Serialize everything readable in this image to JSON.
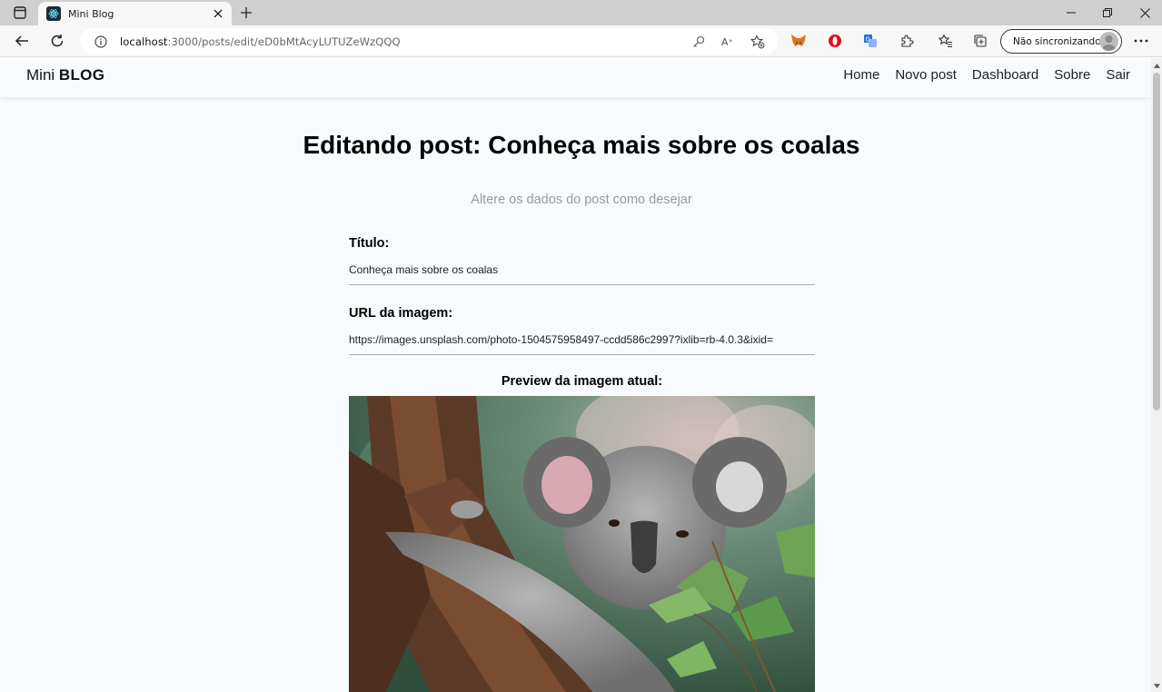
{
  "browser": {
    "tab_title": "Mini Blog",
    "url_host": "localhost",
    "url_path": ":3000/posts/edit/eD0bMtAcyLUTUZeWzQQQ",
    "sync_label": "Não sincronizando"
  },
  "navbar": {
    "brand_light": "Mini ",
    "brand_bold": "BLOG",
    "links": [
      {
        "label": "Home"
      },
      {
        "label": "Novo post"
      },
      {
        "label": "Dashboard"
      },
      {
        "label": "Sobre"
      },
      {
        "label": "Sair"
      }
    ]
  },
  "page": {
    "title": "Editando post: Conheça mais sobre os coalas",
    "subtitle": "Altere os dados do post como desejar"
  },
  "form": {
    "title_label": "Título:",
    "title_value": "Conheça mais sobre os coalas",
    "image_label": "URL da imagem:",
    "image_value": "https://images.unsplash.com/photo-1504575958497-ccdd586c2997?ixlib=rb-4.0.3&ixid=",
    "preview_label": "Preview da imagem atual:"
  },
  "colors": {
    "page_bg": "#f8fbfd",
    "subtitle": "#9a9a9a"
  }
}
